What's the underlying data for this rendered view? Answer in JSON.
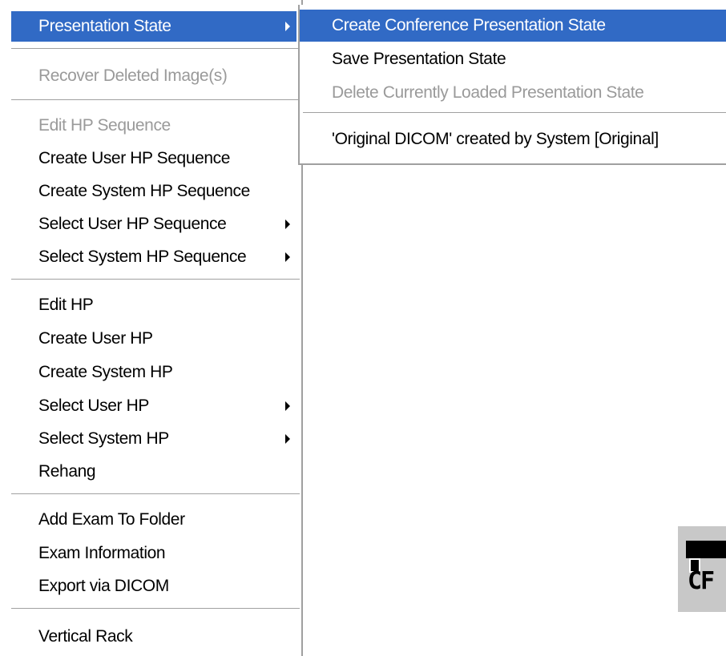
{
  "main_menu": {
    "items": [
      {
        "label": "Presentation State",
        "state": "highlighted",
        "submenu": true
      },
      {
        "label": "Recover Deleted Image(s)",
        "state": "disabled",
        "submenu": false
      },
      {
        "label": "Edit HP Sequence",
        "state": "disabled",
        "submenu": false
      },
      {
        "label": "Create User HP Sequence",
        "state": "enabled",
        "submenu": false
      },
      {
        "label": "Create System HP Sequence",
        "state": "enabled",
        "submenu": false
      },
      {
        "label": "Select User HP Sequence",
        "state": "enabled",
        "submenu": true
      },
      {
        "label": "Select System HP Sequence",
        "state": "enabled",
        "submenu": true
      },
      {
        "label": "Edit HP",
        "state": "enabled",
        "submenu": false
      },
      {
        "label": "Create User HP",
        "state": "enabled",
        "submenu": false
      },
      {
        "label": "Create System HP",
        "state": "enabled",
        "submenu": false
      },
      {
        "label": "Select User HP",
        "state": "enabled",
        "submenu": true
      },
      {
        "label": "Select System HP",
        "state": "enabled",
        "submenu": true
      },
      {
        "label": "Rehang",
        "state": "enabled",
        "submenu": false
      },
      {
        "label": "Add Exam To Folder",
        "state": "enabled",
        "submenu": false
      },
      {
        "label": "Exam Information",
        "state": "enabled",
        "submenu": false
      },
      {
        "label": "Export via DICOM",
        "state": "enabled",
        "submenu": false
      },
      {
        "label": "Vertical Rack",
        "state": "enabled",
        "submenu": false
      }
    ]
  },
  "sub_menu": {
    "items": [
      {
        "label": "Create Conference Presentation State",
        "state": "highlighted"
      },
      {
        "label": "Save Presentation State",
        "state": "enabled"
      },
      {
        "label": "Delete Currently Loaded Presentation State",
        "state": "disabled"
      },
      {
        "label": "'Original DICOM' created by System [Original]",
        "state": "enabled"
      }
    ]
  },
  "corner_thumbnail": {
    "text": "CF"
  },
  "colors": {
    "highlight": "#316ac5",
    "disabled_text": "#9a9a9a",
    "separator": "#a0a0a0"
  }
}
